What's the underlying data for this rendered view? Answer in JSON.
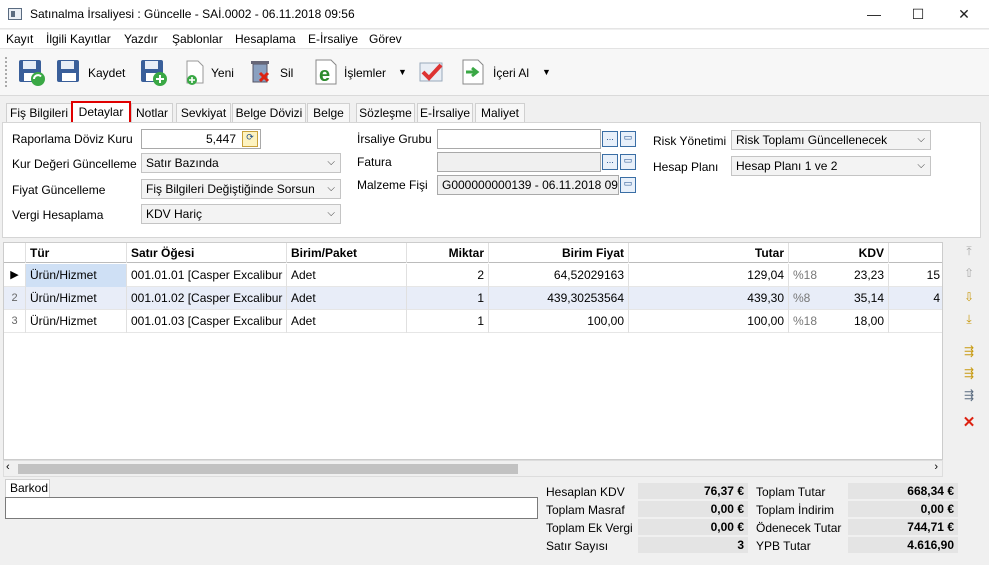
{
  "window": {
    "title": "Satınalma İrsaliyesi : Güncelle - SAİ.0002 - 06.11.2018 09:56",
    "minimize": "—",
    "maximize": "☐",
    "close": "✕"
  },
  "menu": [
    "Kayıt",
    "İlgili Kayıtlar",
    "Yazdır",
    "Şablonlar",
    "Hesaplama",
    "E-İrsaliye",
    "Görev"
  ],
  "toolbar": {
    "save_label": "Kaydet",
    "new_label": "Yeni",
    "delete_label": "Sil",
    "actions_label": "İşlemler",
    "import_label": "İçeri Al",
    "dropdown_glyph": "▼"
  },
  "tabs": [
    "Fiş Bilgileri",
    "Detaylar",
    "Notlar",
    "Sevkiyat",
    "Belge Dövizi",
    "Belge",
    "Sözleşme",
    "E-İrsaliye",
    "Maliyet"
  ],
  "active_tab": "Detaylar",
  "form": {
    "rate_label": "Raporlama Döviz Kuru",
    "rate_value": "5,447",
    "kur_label": "Kur Değeri Güncelleme",
    "kur_value": "Satır Bazında",
    "fiyat_label": "Fiyat Güncelleme",
    "fiyat_value": "Fiş Bilgileri Değiştiğinde Sorsun",
    "vergi_label": "Vergi Hesaplama",
    "vergi_value": "KDV Hariç",
    "grup_label": "İrsaliye Grubu",
    "grup_value": "",
    "fatura_label": "Fatura",
    "fatura_value": "",
    "malzeme_label": "Malzeme Fişi",
    "malzeme_value": "G000000000139 - 06.11.2018 09",
    "risk_label": "Risk Yönetimi",
    "risk_value": "Risk Toplamı Güncellenecek",
    "hesap_label": "Hesap Planı",
    "hesap_value": "Hesap Planı 1 ve 2",
    "ellipsis": "..."
  },
  "grid": {
    "columns": [
      "Tür",
      "Satır Öğesi",
      "Birim/Paket",
      "Miktar",
      "Birim Fiyat",
      "Tutar",
      "KDV"
    ],
    "rows": [
      {
        "ind": "▶",
        "tur": "Ürün/Hizmet",
        "oge": "001.01.01 [Casper Excalibur ...",
        "birim": "Adet",
        "miktar": "2",
        "fiyat": "64,52029163",
        "tutar": "129,04",
        "oran": "%18",
        "kdv": "23,23",
        "extra": "15"
      },
      {
        "ind": "2",
        "tur": "Ürün/Hizmet",
        "oge": "001.01.02 [Casper Excalibur ...",
        "birim": "Adet",
        "miktar": "1",
        "fiyat": "439,30253564",
        "tutar": "439,30",
        "oran": "%8",
        "kdv": "35,14",
        "extra": "4"
      },
      {
        "ind": "3",
        "tur": "Ürün/Hizmet",
        "oge": "001.01.03 [Casper Excalibur ...",
        "birim": "Adet",
        "miktar": "1",
        "fiyat": "100,00",
        "tutar": "100,00",
        "oran": "%18",
        "kdv": "18,00",
        "extra": ""
      }
    ]
  },
  "barkod": {
    "tab_label": "Barkod",
    "value": ""
  },
  "totals": {
    "hesaplan_kdv_label": "Hesaplan KDV",
    "hesaplan_kdv": "76,37 €",
    "toplam_masraf_label": "Toplam Masraf",
    "toplam_masraf": "0,00 €",
    "toplam_ek_vergi_label": "Toplam Ek Vergi",
    "toplam_ek_vergi": "0,00 €",
    "satir_sayisi_label": "Satır Sayısı",
    "satir_sayisi": "3",
    "toplam_tutar_label": "Toplam Tutar",
    "toplam_tutar": "668,34 €",
    "toplam_indirim_label": "Toplam İndirim",
    "toplam_indirim": "0,00 €",
    "odenecek_tutar_label": "Ödenecek Tutar",
    "odenecek_tutar": "744,71 €",
    "ypb_tutar_label": "YPB Tutar",
    "ypb_tutar": "4.616,90"
  },
  "colors": {
    "accent": "#e00000",
    "selection": "#cfe0f5",
    "alt_row": "#e8edf8"
  }
}
